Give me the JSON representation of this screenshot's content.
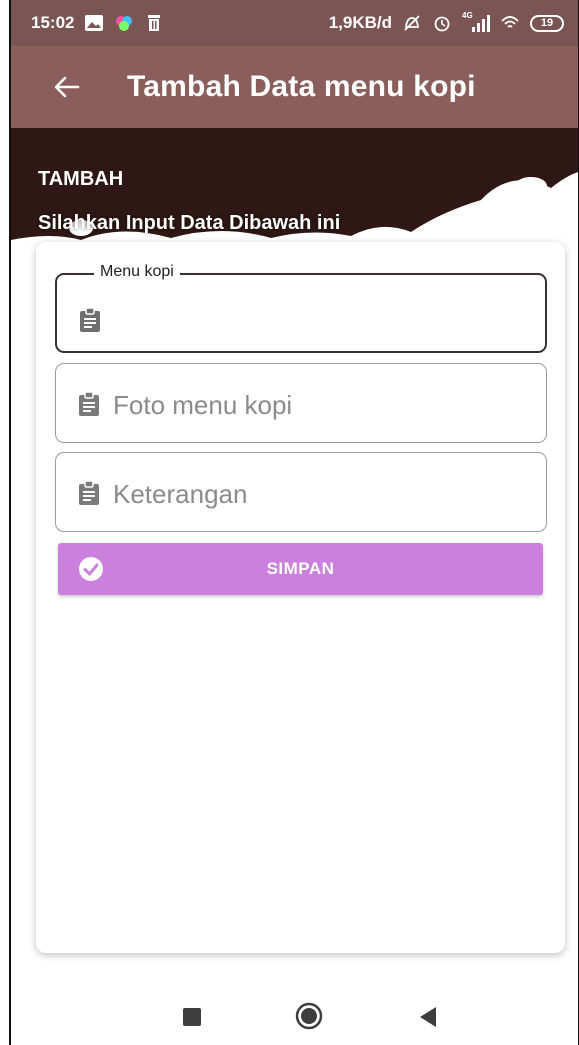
{
  "status_bar": {
    "time": "15:02",
    "network_speed": "1,9KB/d",
    "signal_type": "4G",
    "battery": "19",
    "icons": [
      "photo-app-icon",
      "colorful-app-icon",
      "trash-icon",
      "mute-icon",
      "alarm-icon",
      "signal-icon",
      "wifi-icon",
      "battery-icon"
    ]
  },
  "app_bar": {
    "title": "Tambah Data menu kopi",
    "back_icon": "arrow-left-icon",
    "color": "#8a5e5b"
  },
  "header": {
    "title": "TAMBAH",
    "subtitle": "Silahkan Input Data Dibawah ini",
    "color": "#2e1714"
  },
  "form": {
    "fields": [
      {
        "label": "Menu kopi",
        "placeholder": "",
        "value": "",
        "icon": "clipboard-icon",
        "focused": true
      },
      {
        "label": "",
        "placeholder": "Foto menu kopi",
        "value": "",
        "icon": "clipboard-icon",
        "focused": false
      },
      {
        "label": "",
        "placeholder": "Keterangan",
        "value": "",
        "icon": "clipboard-icon",
        "focused": false
      }
    ],
    "save_button": {
      "label": "SIMPAN",
      "icon": "check-circle-icon",
      "color": "#cc80dd"
    }
  },
  "nav_bar": {
    "icons": [
      "recent-apps-icon",
      "home-icon",
      "back-icon"
    ]
  }
}
